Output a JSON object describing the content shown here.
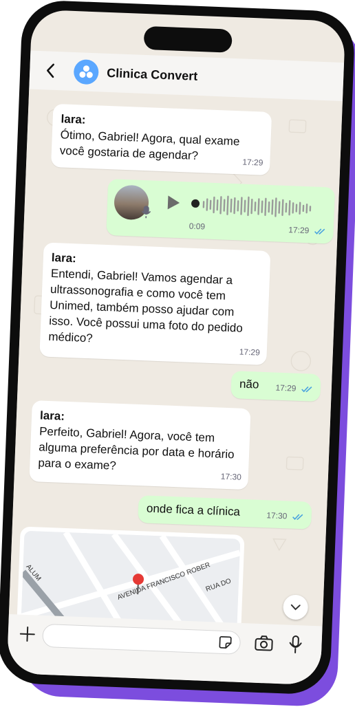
{
  "header": {
    "title": "Clinica Convert"
  },
  "messages": [
    {
      "sender": "lara:",
      "text": "Ótimo, Gabriel! Agora, qual exame você gostaria de agendar?",
      "time": "17:29"
    },
    {
      "audio_duration": "0:09",
      "time": "17:29"
    },
    {
      "sender": "lara:",
      "text": "Entendi, Gabriel! Vamos agendar a ultrassonografia e como você tem Unimed, também posso ajudar com isso. Você possui uma foto do pedido médico?",
      "time": "17:29"
    },
    {
      "text": "não",
      "time": "17:29"
    },
    {
      "sender": "lara:",
      "text": "Perfeito, Gabriel! Agora, você tem alguma preferência por data e horário para o exame?",
      "time": "17:30"
    },
    {
      "text": "onde fica a clínica",
      "time": "17:30"
    }
  ],
  "map": {
    "streets": [
      "AVENIDA FRANCISCO ROBER",
      "RUA DO",
      "ALUM"
    ]
  },
  "input": {
    "placeholder": ""
  },
  "colors": {
    "accent": "#7c4dde",
    "outgoing": "#d9fdd3",
    "incoming": "#ffffff",
    "tick": "#4aa3df"
  }
}
